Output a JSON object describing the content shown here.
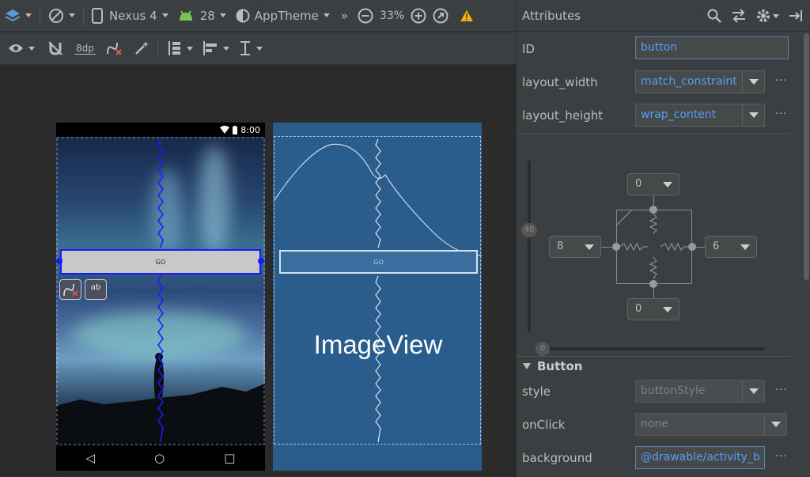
{
  "toolbar": {
    "device": "Nexus 4",
    "api_level": "28",
    "theme": "AppTheme",
    "more": "»",
    "zoom": "33%",
    "margin_default": "8dp"
  },
  "phone": {
    "clock": "8:00",
    "button_label": "GO"
  },
  "blueprint": {
    "imageview_label": "ImageView",
    "button_label": "GO"
  },
  "attributes": {
    "title": "Attributes",
    "id_label": "ID",
    "id_value": "button",
    "layout_width_label": "layout_width",
    "layout_width_value": "match_constraint",
    "layout_height_label": "layout_height",
    "layout_height_value": "wrap_content",
    "more_label": "···",
    "constraints": {
      "top": "0",
      "bottom": "0",
      "left": "8",
      "right": "6",
      "vertical_bias": "40",
      "horizontal_bias": "0"
    },
    "section_button": "Button",
    "style_label": "style",
    "style_value": "buttonStyle",
    "onclick_label": "onClick",
    "onclick_value": "none",
    "background_label": "background",
    "background_value": "@drawable/activity_b"
  },
  "colors": {
    "accent_blue": "#589df6",
    "selection_blue": "#1a1aff",
    "blueprint_bg": "#2a5d8c",
    "warning": "#f0b400"
  }
}
